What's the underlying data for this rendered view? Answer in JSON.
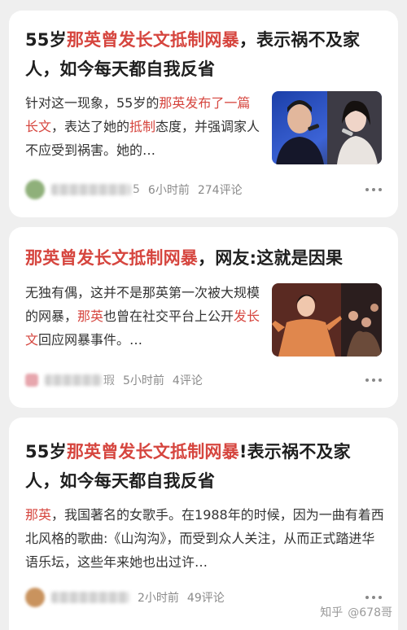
{
  "cards": [
    {
      "title_pre": "55岁",
      "title_hl": "那英曾发长文抵制网暴",
      "title_post": "，表示祸不及家人，如今每天都自我反省",
      "excerpt": {
        "a": "针对这一现象，55岁的",
        "b": "那英发布了一篇长文",
        "c": "，表达了她的",
        "d": "抵制",
        "e": "态度，并强调家人不应受到祸害。她的…"
      },
      "author_tail": "5",
      "time": "6小时前",
      "comments": "274评论",
      "thumb_icon": "singers-photo",
      "avatar_color": "#8fb07a"
    },
    {
      "title_hl": "那英曾发长文抵制网暴",
      "title_post": "，网友:这就是因果",
      "excerpt": {
        "a": "无独有偶，这并不是那英第一次被大规模的网暴，",
        "b": "那英",
        "c": "也曾在社交平台上公开",
        "d": "发长文",
        "e": "回应网暴事件。…"
      },
      "author_tail": "瑕",
      "time": "5小时前",
      "comments": "4评论",
      "thumb_icon": "stage-photo",
      "avatar_color": "#e7a6ad"
    },
    {
      "title_pre": "55岁",
      "title_hl": "那英曾发长文抵制网暴",
      "title_post": "!表示祸不及家人，如今每天都自我反省",
      "excerpt": {
        "a": "那英",
        "b": "，我国著名的女歌手。在1988年的时候，因为一曲有着西北风格的歌曲:《山沟沟》，而受到众人关注，从而正式踏进华语乐坛，这些年来她也出过许…"
      },
      "author_tail": "",
      "time": "2小时前",
      "comments": "49评论",
      "avatar_color": "#c9935e"
    }
  ],
  "watermark": {
    "brand": "知乎",
    "user": "@678哥"
  },
  "colors": {
    "highlight": "#d6463f",
    "background": "#efefef"
  }
}
